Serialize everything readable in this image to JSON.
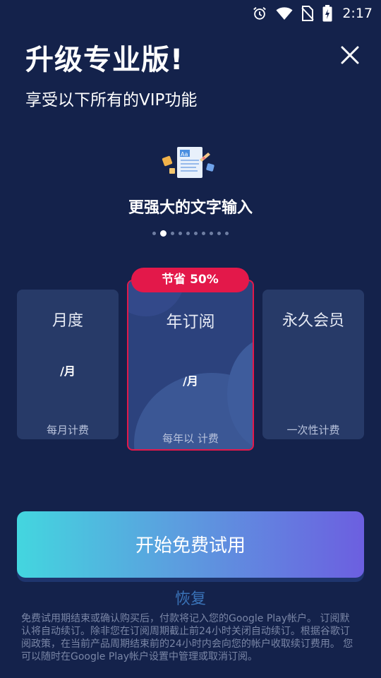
{
  "status_bar": {
    "time": "2:17",
    "icons": [
      "alarm-icon",
      "wifi-icon",
      "no-sim-icon",
      "battery-charging-icon"
    ]
  },
  "header": {
    "title": "升级专业版!",
    "subtitle": "享受以下所有的VIP功能",
    "close_icon": "close-icon"
  },
  "feature": {
    "title": "更强大的文字输入",
    "page_count": 10,
    "active_page": 2
  },
  "plans": [
    {
      "name": "月度",
      "price": "/月",
      "note": "每月计费"
    },
    {
      "name": "年订阅",
      "price": "/月",
      "note": "每年以 计费",
      "badge": "节省 50%",
      "selected": true
    },
    {
      "name": "永久会员",
      "price": "",
      "note": "一次性计费"
    }
  ],
  "cta": {
    "label": "开始免费试用"
  },
  "restore": {
    "label": "恢复"
  },
  "legal": {
    "text": "免费试用期结束或确认购买后，付款将记入您的Google Play帐户。 订阅默认将自动续订。除非您在订阅周期截止前24小时关闭自动续订。根据谷歌订阅政策，在当前产品周期结束前的24小时内会向您的帐户收取续订费用。 您可以随时在Google Play帐户设置中管理或取消订阅。"
  },
  "colors": {
    "background": "#14224b",
    "accent_red": "#e3184a",
    "cta_start": "#43d6df",
    "cta_end": "#6c5fe0",
    "restore_link": "#3a73b8"
  }
}
